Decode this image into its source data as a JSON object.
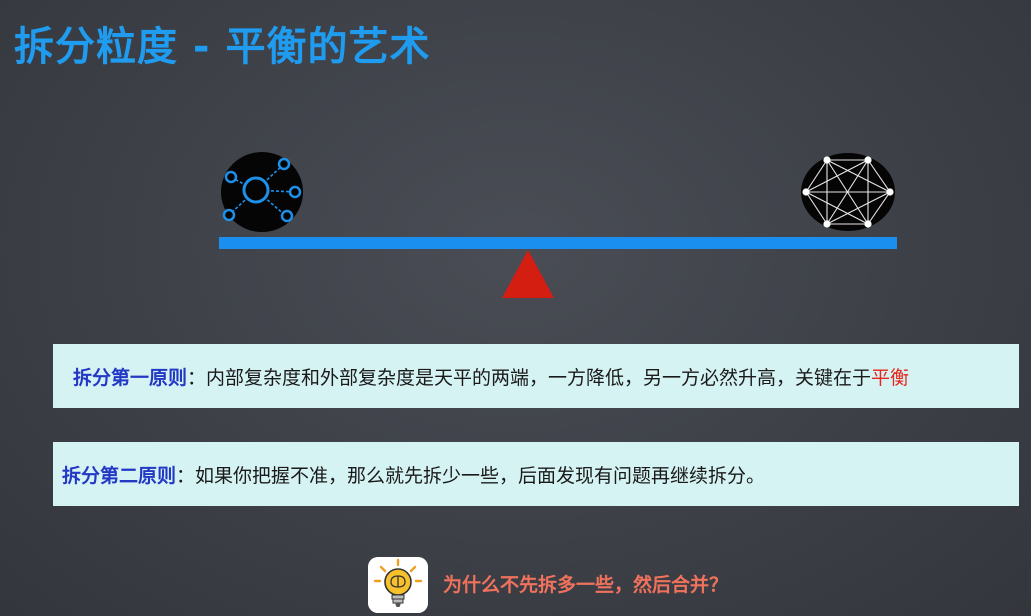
{
  "slide": {
    "title": "拆分粒度 - 平衡的艺术"
  },
  "principles": [
    {
      "label": "拆分第一原则",
      "separator": "：",
      "text": "内部复杂度和外部复杂度是天平的两端，一方降低，另一方必然升高，关键在于",
      "highlight": "平衡",
      "highlight_color": "#e8241c"
    },
    {
      "label": "拆分第二原则",
      "separator": "：",
      "text": "如果你把握不准，那么就先拆少一些，后面发现有问题再继续拆分。"
    }
  ],
  "tip": {
    "icon": "lightbulb-brain-icon",
    "text": "为什么不先拆多一些，然后合并？"
  },
  "diagram": {
    "left_icon": "hub-network-icon",
    "right_icon": "mesh-network-icon",
    "beam_color": "#1a8ff0",
    "fulcrum_color": "#d41e12"
  },
  "colors": {
    "title": "#1f9cf0",
    "label": "#2338c4",
    "tip": "#f0725c",
    "panel": "#d6f3f4"
  }
}
